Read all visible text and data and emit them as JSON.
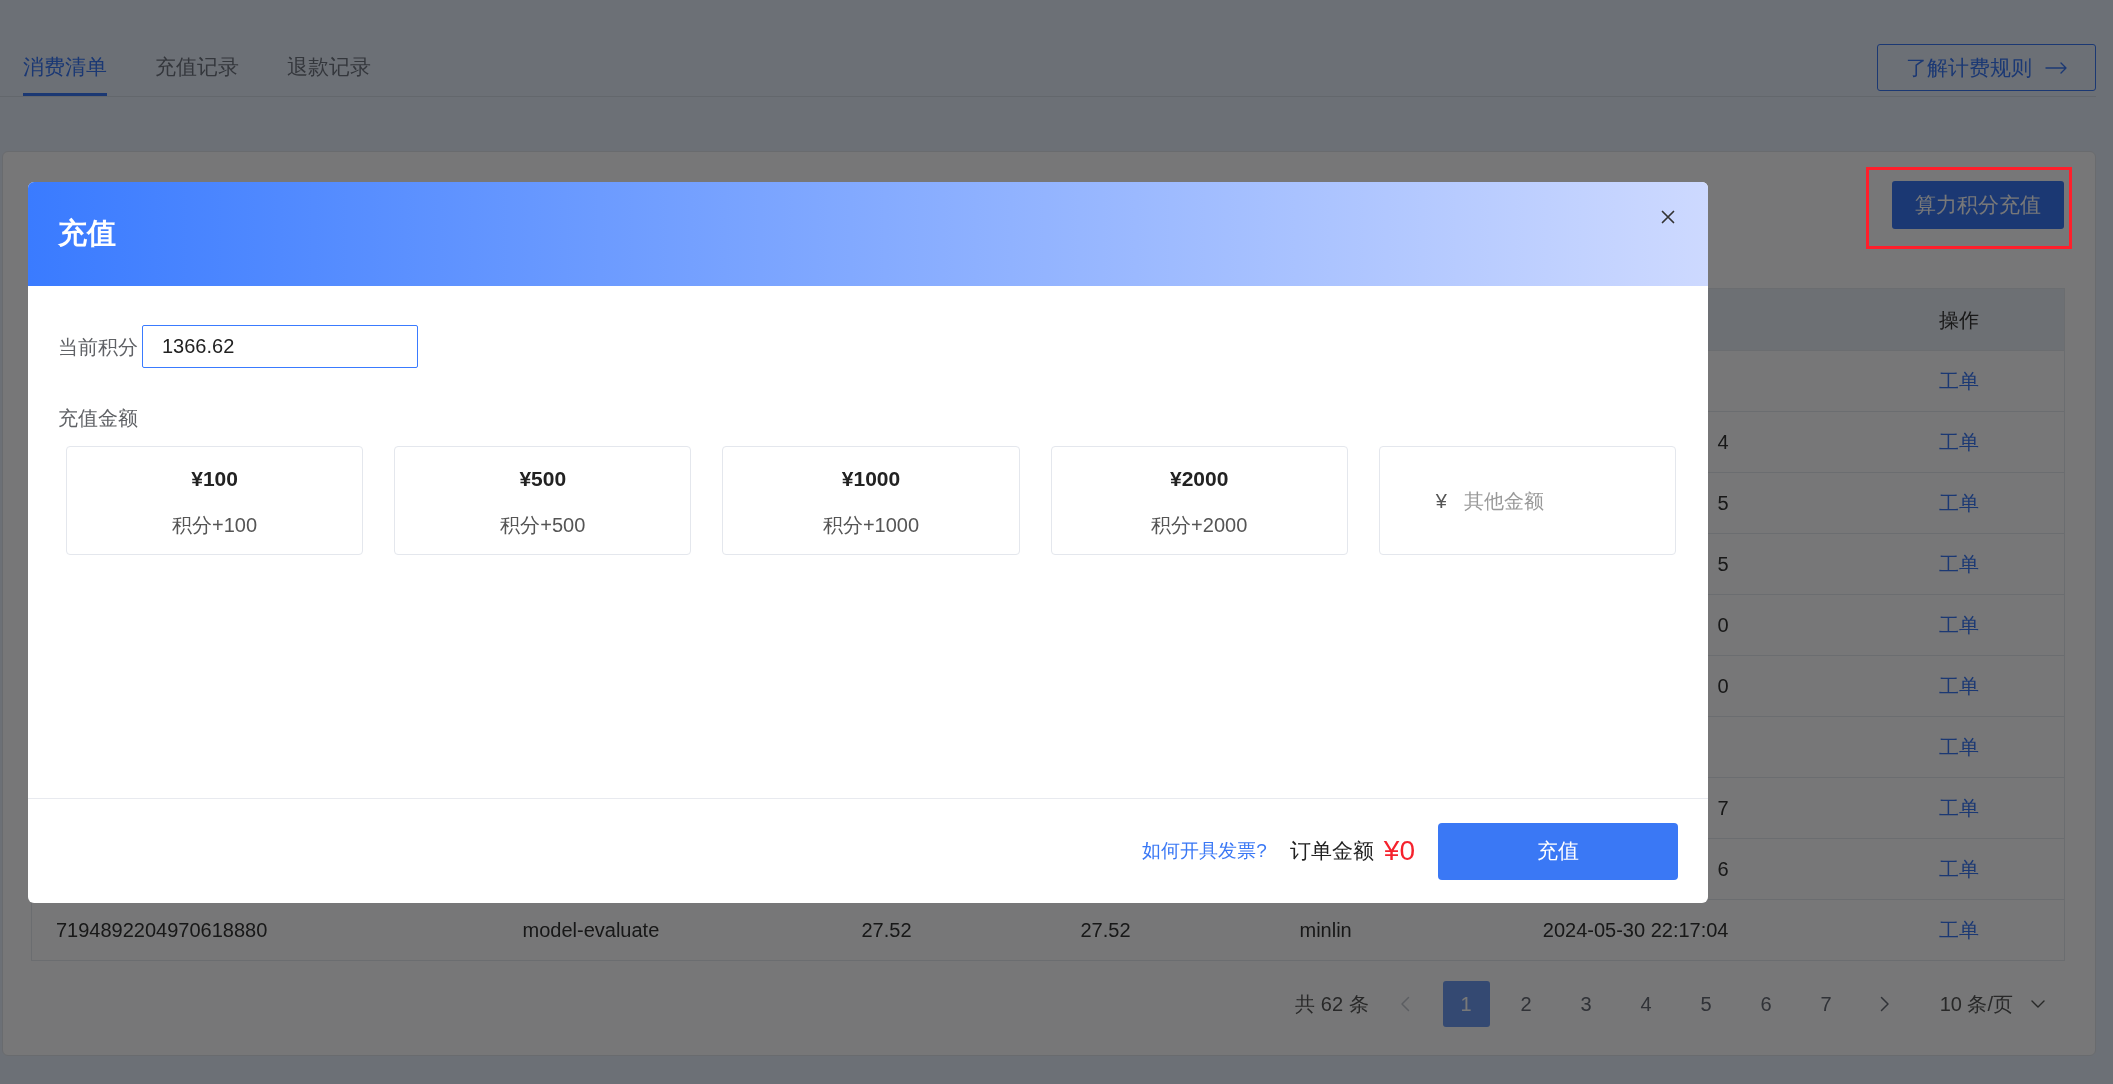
{
  "tabs": [
    {
      "label": "消费清单",
      "selected": true
    },
    {
      "label": "充值记录",
      "selected": false
    },
    {
      "label": "退款记录",
      "selected": false
    }
  ],
  "rules_button": {
    "label": "了解计费规则"
  },
  "recharge_button": {
    "label": "算力积分充值",
    "highlighted": true
  },
  "table": {
    "header": {
      "column_7": "操作"
    },
    "rows": [
      {
        "column_7": "工单"
      },
      {
        "column_6": "4",
        "column_7": "工单"
      },
      {
        "column_6": "5",
        "column_7": "工单"
      },
      {
        "column_6": "5",
        "column_7": "工单"
      },
      {
        "column_6": "0",
        "column_7": "工单"
      },
      {
        "column_6": "0",
        "column_7": "工单"
      },
      {
        "column_7": "工单"
      },
      {
        "column_6": "7",
        "column_7": "工单"
      },
      {
        "column_6": "6",
        "column_7": "工单"
      },
      {
        "column_1": "7194892204970618880",
        "column_2": "model-evaluate",
        "column_3": "27.52",
        "column_4": "27.52",
        "column_5": "minlin",
        "column_6": "2024-05-30 22:17:04",
        "column_7": "工单"
      }
    ]
  },
  "pagination": {
    "total": "共 62 条",
    "prev": {
      "disabled": true
    },
    "pages": [
      {
        "label": "1",
        "selected": true
      },
      {
        "label": "2",
        "selected": false
      },
      {
        "label": "3",
        "selected": false
      },
      {
        "label": "4",
        "selected": false
      },
      {
        "label": "5",
        "selected": false
      },
      {
        "label": "6",
        "selected": false
      },
      {
        "label": "7",
        "selected": false
      }
    ],
    "next": {
      "disabled": false
    },
    "page_size": "10 条/页"
  },
  "dialog": {
    "title": "充值",
    "balance": {
      "label": "当前积分",
      "value": "1366.62"
    },
    "amount_label": "充值金额",
    "options": [
      {
        "kind": "preset",
        "price": "¥100",
        "points": "积分+100",
        "selected": false
      },
      {
        "kind": "preset",
        "price": "¥500",
        "points": "积分+500",
        "selected": false
      },
      {
        "kind": "preset",
        "price": "¥1000",
        "points": "积分+1000",
        "selected": false
      },
      {
        "kind": "preset",
        "price": "¥2000",
        "points": "积分+2000",
        "selected": false
      },
      {
        "kind": "custom",
        "currency": "¥",
        "placeholder": "其他金额",
        "selected": false
      }
    ],
    "footer": {
      "invoice_link": "如何开具发票?",
      "total_label": "订单金额",
      "total": "¥0",
      "submit": "充值"
    }
  }
}
